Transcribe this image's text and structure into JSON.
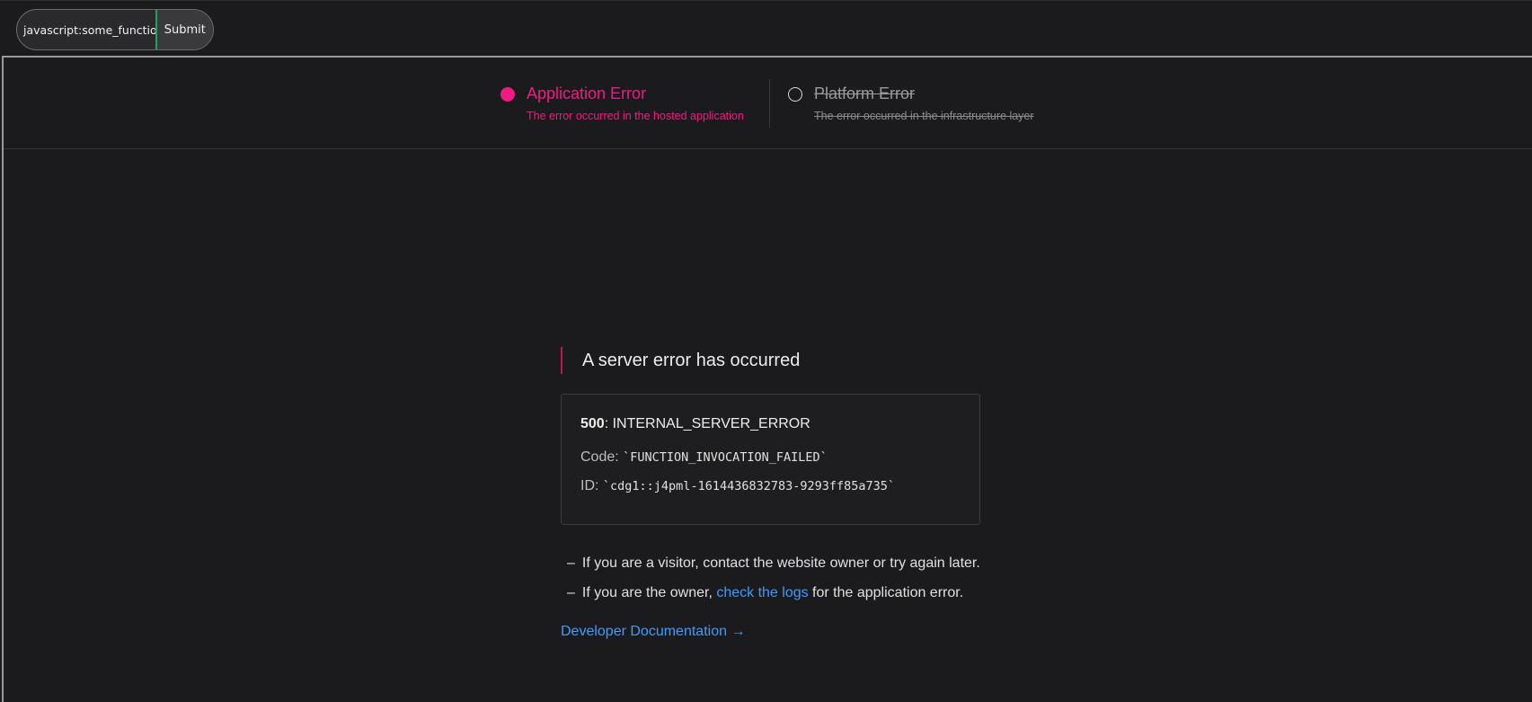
{
  "toolbar": {
    "url_value": "javascript:some_functio",
    "submit_label": "Submit"
  },
  "error_types": {
    "application": {
      "title": "Application Error",
      "description": "The error occurred in the hosted application",
      "selected": true
    },
    "platform": {
      "title": "Platform Error",
      "description": "The error occurred in the infrastructure layer",
      "selected": false
    }
  },
  "main": {
    "headline": "A server error has occurred",
    "status_code": "500",
    "status_text": ": INTERNAL_SERVER_ERROR",
    "code_label": "Code:",
    "code_value": "`FUNCTION_INVOCATION_FAILED`",
    "id_label": "ID:",
    "id_value": "`cdg1::j4pml-1614436832783-9293ff85a735`",
    "bullet_dash": "–",
    "visitor_text": "If you are a visitor, contact the website owner or try again later.",
    "owner_prefix": "If you are the owner, ",
    "owner_link": "check the logs",
    "owner_suffix": " for the application error.",
    "dev_docs": "Developer Documentation →"
  },
  "colors": {
    "accent_pink": "#f01b82",
    "link_blue": "#3d9cff",
    "submit_border_green": "#19a463",
    "background": "#1b1b1d"
  }
}
